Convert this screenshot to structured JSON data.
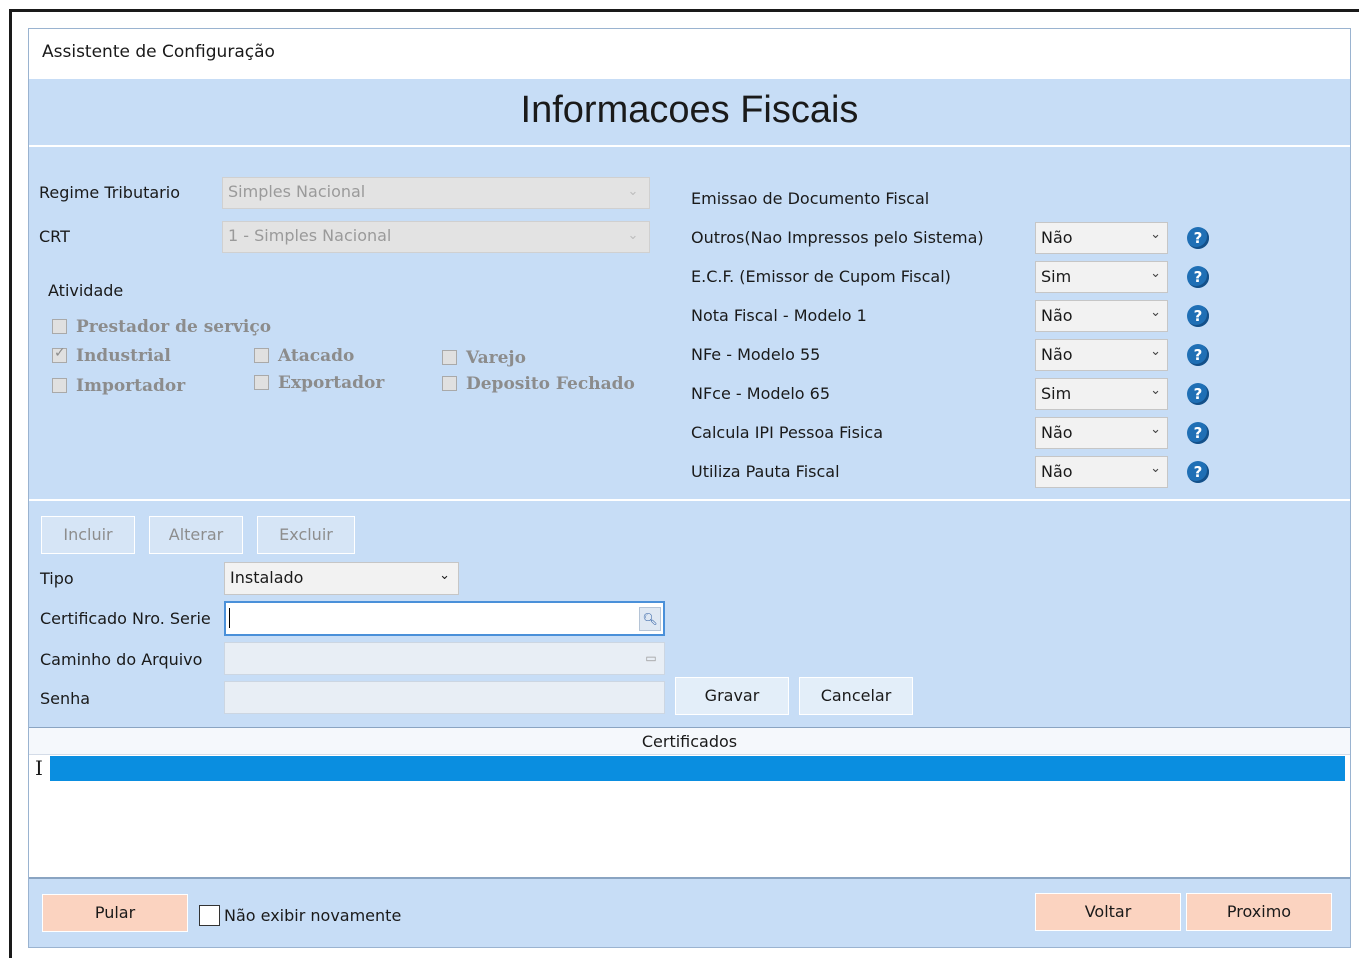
{
  "window": {
    "title": "Assistente de Configuração"
  },
  "header": {
    "title": "Informacoes Fiscais"
  },
  "left": {
    "regime_label": "Regime Tributario",
    "regime_value": "Simples Nacional",
    "crt_label": "CRT",
    "crt_value": "1 - Simples Nacional",
    "atividade_label": "Atividade",
    "checkboxes": [
      {
        "label": "Prestador de serviço",
        "checked": false
      },
      {
        "label": "Industrial",
        "checked": true
      },
      {
        "label": "Atacado",
        "checked": false
      },
      {
        "label": "Varejo",
        "checked": false
      },
      {
        "label": "Importador",
        "checked": false
      },
      {
        "label": "Exportador",
        "checked": false
      },
      {
        "label": "Deposito Fechado",
        "checked": false
      }
    ]
  },
  "right": {
    "section_label": "Emissao de Documento Fiscal",
    "rows": [
      {
        "label": "Outros(Nao Impressos pelo Sistema)",
        "value": "Não"
      },
      {
        "label": "E.C.F. (Emissor de Cupom Fiscal)",
        "value": "Sim"
      },
      {
        "label": "Nota Fiscal - Modelo 1",
        "value": "Não"
      },
      {
        "label": "NFe - Modelo 55",
        "value": "Não"
      },
      {
        "label": "NFce - Modelo 65",
        "value": "Sim"
      },
      {
        "label": "Calcula IPI Pessoa Fisica",
        "value": "Não"
      },
      {
        "label": "Utiliza Pauta Fiscal",
        "value": "Não"
      }
    ]
  },
  "cert": {
    "incluir": "Incluir",
    "alterar": "Alterar",
    "excluir": "Excluir",
    "tipo_label": "Tipo",
    "tipo_value": "Instalado",
    "serie_label": "Certificado Nro. Serie",
    "caminho_label": "Caminho do Arquivo",
    "senha_label": "Senha",
    "gravar": "Gravar",
    "cancelar": "Cancelar",
    "grid_title": "Certificados"
  },
  "footer": {
    "pular": "Pular",
    "nao_exibir": "Não exibir novamente",
    "voltar": "Voltar",
    "proximo": "Proximo"
  },
  "icons": {
    "help": "question-circle-icon",
    "dropdown": "chevron-down-icon",
    "search": "magnifier-icon",
    "folder": "folder-icon"
  }
}
